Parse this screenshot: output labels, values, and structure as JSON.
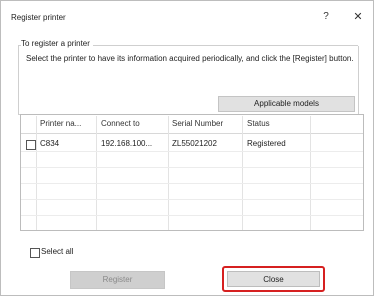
{
  "window": {
    "title": "Register printer",
    "help_glyph": "?",
    "close_glyph": "✕"
  },
  "group": {
    "legend": "To register a printer",
    "instructions": "Select the printer to have its information acquired periodically, and click the [Register] button."
  },
  "buttons": {
    "applicable_models": "Applicable models",
    "register": "Register",
    "close": "Close"
  },
  "table": {
    "columns": [
      "Printer na...",
      "Connect to",
      "Serial Number",
      "Status"
    ],
    "rows": [
      {
        "checked": false,
        "printer_name": "C834",
        "connect_to": "192.168.100...",
        "serial_number": "ZL55021202",
        "status": "Registered"
      }
    ]
  },
  "select_all": {
    "label": "Select all",
    "checked": false
  },
  "colors": {
    "highlight_border": "#d62020",
    "button_face": "#e1e1e1",
    "disabled_text": "#8a8a8a"
  }
}
